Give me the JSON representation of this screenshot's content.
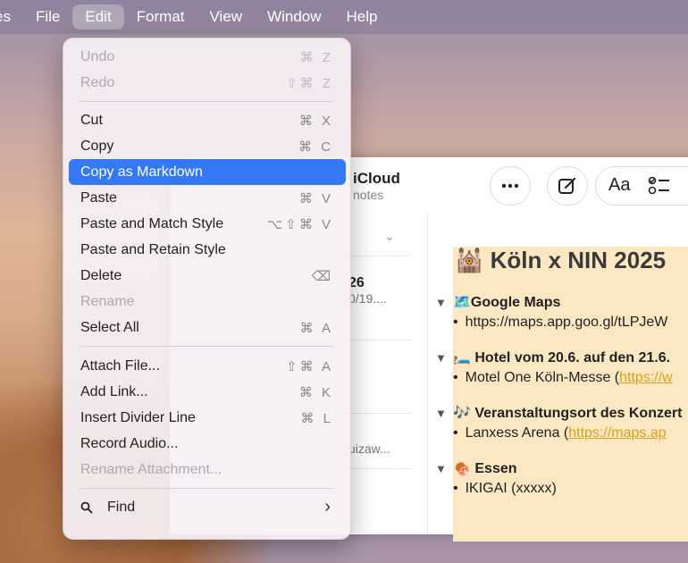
{
  "menubar": {
    "items": [
      "es",
      "File",
      "Edit",
      "Format",
      "View",
      "Window",
      "Help"
    ]
  },
  "window": {
    "title": "iCloud",
    "subtitle": "notes",
    "more_icon": "ellipsis-icon",
    "compose_icon": "compose-icon",
    "format_label": "Aa",
    "checklist_icon": "checklist-icon",
    "list": [
      {
        "title": "26",
        "subtitle": "0/19...."
      },
      {
        "title": "",
        "subtitle": "uizaw..."
      }
    ]
  },
  "note": {
    "title": "🕍 Köln x NIN 2025",
    "sections": [
      {
        "head": "🗺️Google Maps",
        "bullet": "https://maps.app.goo.gl/tLPJeW",
        "link": ""
      },
      {
        "head": "🛏️ Hotel vom 20.6. auf den 21.6.",
        "bullet": "Motel One Köln-Messe (",
        "link": "https://w"
      },
      {
        "head": "🎶 Veranstaltungsort des Konzert",
        "bullet": "Lanxess Arena (",
        "link": "https://maps.ap"
      },
      {
        "head": "🍖 Essen",
        "bullet": "IKIGAI (xxxxx)",
        "link": ""
      }
    ]
  },
  "menu": {
    "items": [
      {
        "label": "Undo",
        "shortcut": "⌘ Z",
        "disabled": true
      },
      {
        "label": "Redo",
        "shortcut": "⇧⌘ Z",
        "disabled": true
      },
      {
        "label": "Cut",
        "shortcut": "⌘ X",
        "disabled": false
      },
      {
        "label": "Copy",
        "shortcut": "⌘ C",
        "disabled": false
      },
      {
        "label": "Copy as Markdown",
        "shortcut": "",
        "disabled": false,
        "selected": true
      },
      {
        "label": "Paste",
        "shortcut": "⌘ V",
        "disabled": false
      },
      {
        "label": "Paste and Match Style",
        "shortcut": "⌥⇧⌘ V",
        "disabled": false
      },
      {
        "label": "Paste and Retain Style",
        "shortcut": "",
        "disabled": false
      },
      {
        "label": "Delete",
        "shortcut": "⌫",
        "disabled": false
      },
      {
        "label": "Rename",
        "shortcut": "",
        "disabled": true
      },
      {
        "label": "Select All",
        "shortcut": "⌘ A",
        "disabled": false
      },
      {
        "label": "Attach File...",
        "shortcut": "⇧⌘ A",
        "disabled": false
      },
      {
        "label": "Add Link...",
        "shortcut": "⌘ K",
        "disabled": false
      },
      {
        "label": "Insert Divider Line",
        "shortcut": "⌘ L",
        "disabled": false
      },
      {
        "label": "Record Audio...",
        "shortcut": "",
        "disabled": false
      },
      {
        "label": "Rename Attachment...",
        "shortcut": "",
        "disabled": true
      },
      {
        "label": "Find",
        "shortcut": "›",
        "disabled": false
      }
    ]
  }
}
